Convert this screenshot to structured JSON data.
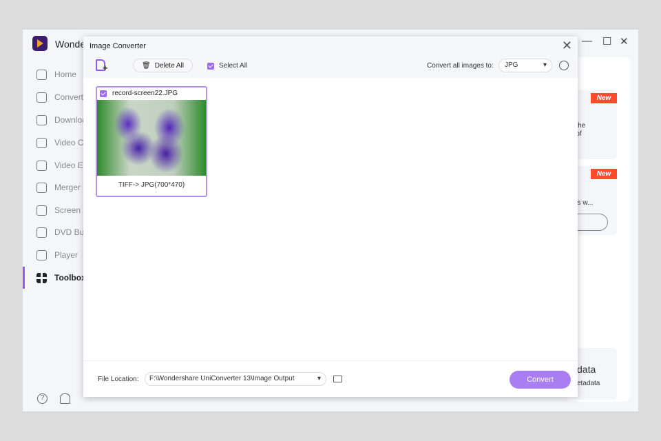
{
  "app": {
    "name": "Wonder",
    "sidebar": [
      {
        "label": "Home",
        "icon": "home-icon"
      },
      {
        "label": "Converte",
        "icon": "converter-icon"
      },
      {
        "label": "Downloa",
        "icon": "download-icon"
      },
      {
        "label": "Video Co",
        "icon": "video-compressor-icon"
      },
      {
        "label": "Video Ed",
        "icon": "video-editor-icon"
      },
      {
        "label": "Merger",
        "icon": "merger-icon"
      },
      {
        "label": "Screen R",
        "icon": "screen-recorder-icon"
      },
      {
        "label": "DVD Bu",
        "icon": "dvd-icon"
      },
      {
        "label": "Player",
        "icon": "player-icon"
      },
      {
        "label": "Toolbox",
        "icon": "toolbox-icon",
        "active": true
      }
    ],
    "right": {
      "badge": "New",
      "t1a": "d the",
      "t1b": "g of",
      "t2": "aits w...",
      "t3": "data",
      "t4": "etadata"
    }
  },
  "dialog": {
    "title": "Image Converter",
    "delete_all": "Delete All",
    "select_all": "Select All",
    "convert_all_label": "Convert all images to:",
    "format": "JPG",
    "items": [
      {
        "name": "record-screen22.JPG",
        "info": "TIFF-> JPG(700*470)",
        "checked": true
      }
    ],
    "file_location_label": "File Location:",
    "file_location": "F:\\Wondershare UniConverter 13\\Image Output",
    "convert": "Convert"
  },
  "colors": {
    "accent": "#9b6cf0",
    "badge": "#ff4b2b"
  }
}
